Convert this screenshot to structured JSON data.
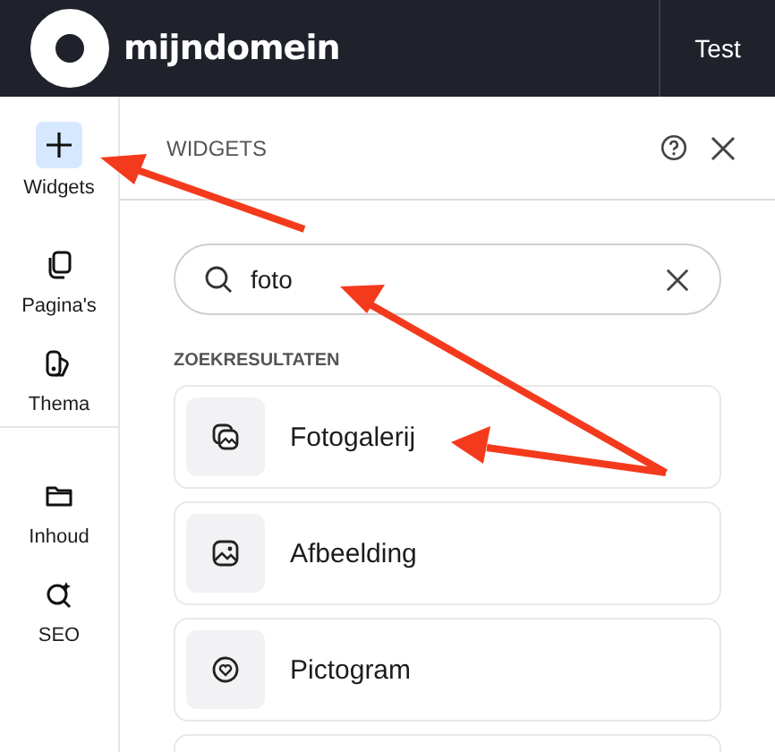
{
  "header": {
    "logo_text": "mijndomein",
    "site_name": "Test"
  },
  "sidebar": {
    "items": [
      {
        "label": "Widgets",
        "selected": true
      },
      {
        "label": "Pagina's",
        "selected": false
      },
      {
        "label": "Thema",
        "selected": false
      },
      {
        "label": "Inhoud",
        "selected": false
      },
      {
        "label": "SEO",
        "selected": false
      }
    ]
  },
  "panel": {
    "title": "WIDGETS",
    "search": {
      "value": "foto"
    },
    "section_title": "ZOEKRESULTATEN",
    "results": [
      {
        "label": "Fotogalerij"
      },
      {
        "label": "Afbeelding"
      },
      {
        "label": "Pictogram"
      }
    ]
  }
}
